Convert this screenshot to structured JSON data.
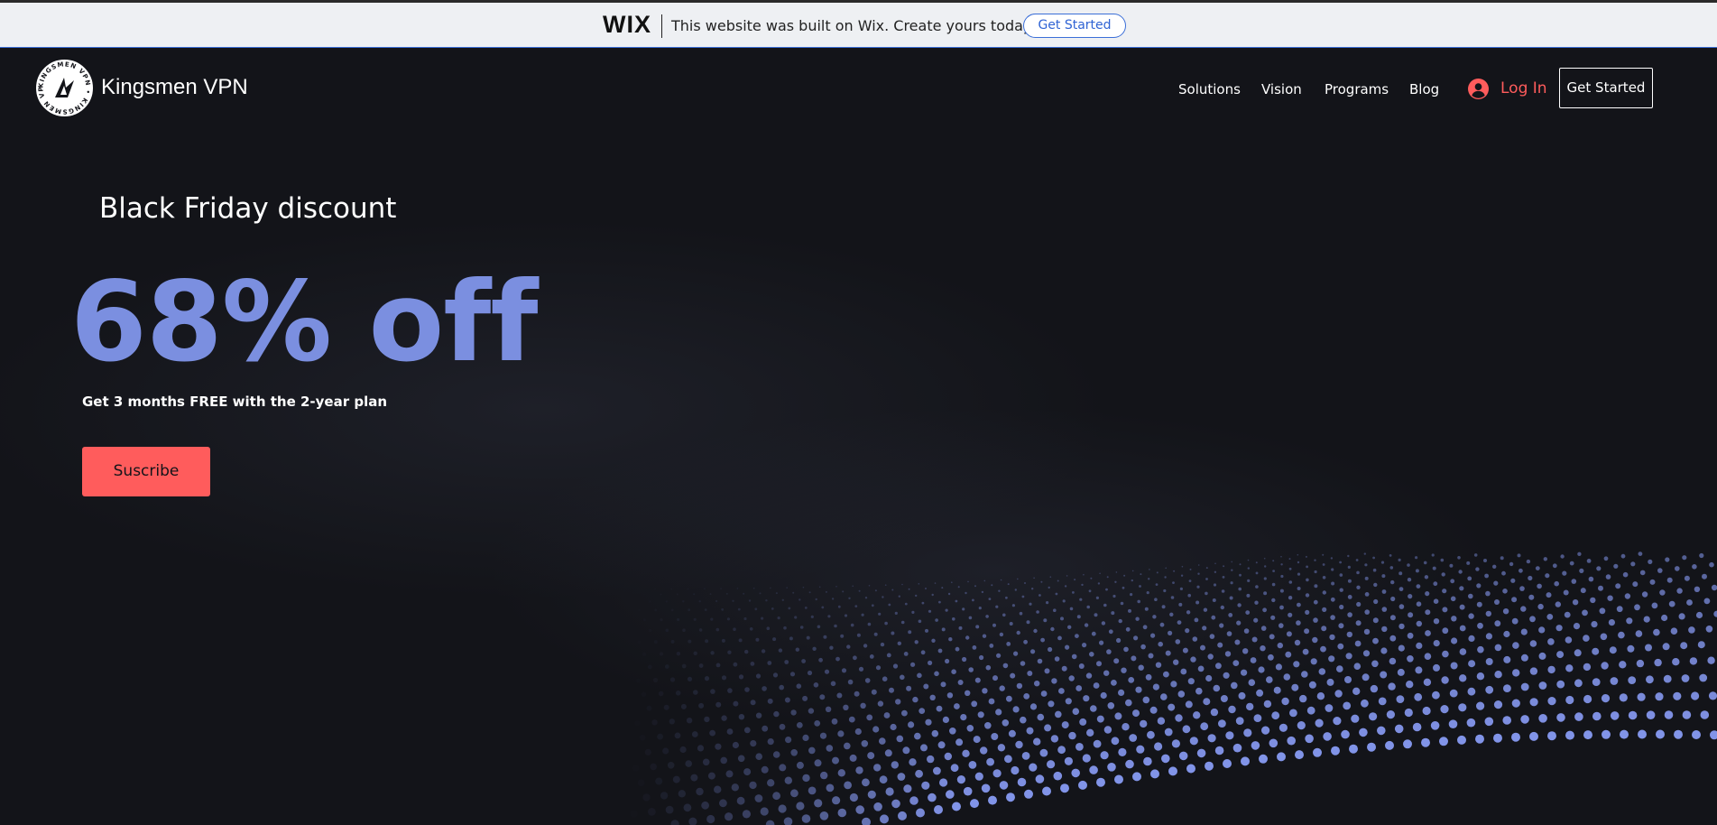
{
  "wix_banner": {
    "logo_text": "WIX",
    "message": "This website was built on Wix. Create yours today.",
    "cta_label": "Get Started"
  },
  "header": {
    "brand_name": "Kingsmen VPN",
    "logo_ring_text": "KINGSMEN VPN",
    "nav_items": [
      "Solutions",
      "Vision",
      "Programs",
      "Blog"
    ],
    "login_label": "Log In",
    "cta_label": "Get Started"
  },
  "hero": {
    "eyebrow": "Black Friday discount",
    "headline": "68% off",
    "subheadline": "Get 3 months FREE with the 2-year plan",
    "button_label": "Suscribe"
  },
  "colors": {
    "background": "#131419",
    "accent_blue": "#7b8fe0",
    "accent_red": "#ff5c5c",
    "wix_blue": "#3b6fd8"
  },
  "icons": {
    "login": "user-avatar-icon",
    "logo": "kingsmen-emblem-icon"
  }
}
